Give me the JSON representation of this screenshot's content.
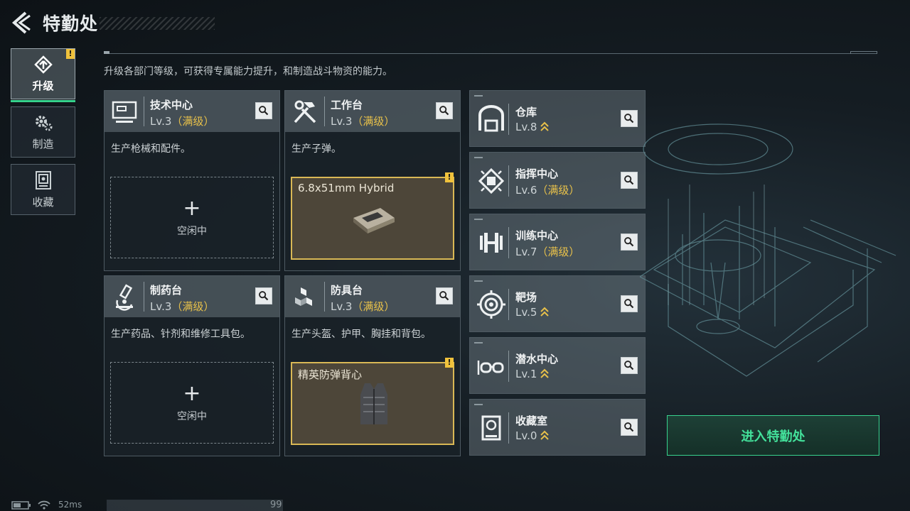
{
  "header": {
    "title": "特勤处",
    "subtitle": "升级各部门等级，可获得专属能力提升，和制造战斗物资的能力。"
  },
  "sidebar": {
    "items": [
      {
        "label": "升级",
        "icon": "upgrade-icon",
        "active": true,
        "badge": "!"
      },
      {
        "label": "制造",
        "icon": "gears-icon",
        "active": false
      },
      {
        "label": "收藏",
        "icon": "collection-icon",
        "active": false
      }
    ]
  },
  "cards": [
    {
      "name": "技术中心",
      "level": "Lv.3",
      "max": "（满级）",
      "desc": "生产枪械和配件。",
      "icon": "monitor-icon",
      "slot": {
        "type": "idle",
        "plus": "+",
        "label": "空闲中"
      }
    },
    {
      "name": "工作台",
      "level": "Lv.3",
      "max": "（满级）",
      "desc": "生产子弹。",
      "icon": "hammer-wrench-icon",
      "slot": {
        "type": "item",
        "item_name": "6.8x51mm Hybrid",
        "badge": "!",
        "item_icon": "ammo-box-icon"
      }
    },
    {
      "name": "制药台",
      "level": "Lv.3",
      "max": "（满级）",
      "desc": "生产药品、针剂和维修工具包。",
      "icon": "microscope-icon",
      "slot": {
        "type": "idle",
        "plus": "+",
        "label": "空闲中"
      }
    },
    {
      "name": "防具台",
      "level": "Lv.3",
      "max": "（满级）",
      "desc": "生产头盔、护甲、胸挂和背包。",
      "icon": "cubes-icon",
      "slot": {
        "type": "item",
        "item_name": "精英防弹背心",
        "badge": "!",
        "item_icon": "vest-icon"
      }
    }
  ],
  "facilities": [
    {
      "name": "仓库",
      "level": "Lv.8",
      "max": "",
      "upgradable": true,
      "icon": "warehouse-icon"
    },
    {
      "name": "指挥中心",
      "level": "Lv.6",
      "max": "（满级）",
      "upgradable": false,
      "icon": "chip-icon"
    },
    {
      "name": "训练中心",
      "level": "Lv.7",
      "max": "（满级）",
      "upgradable": false,
      "icon": "dumbbell-icon"
    },
    {
      "name": "靶场",
      "level": "Lv.5",
      "max": "",
      "upgradable": true,
      "icon": "target-icon"
    },
    {
      "name": "潜水中心",
      "level": "Lv.1",
      "max": "",
      "upgradable": true,
      "icon": "goggles-icon"
    },
    {
      "name": "收藏室",
      "level": "Lv.0",
      "max": "",
      "upgradable": true,
      "icon": "collection-room-icon"
    }
  ],
  "enter_button": "进入特勤处",
  "status": {
    "ping": "52ms",
    "number": "99"
  },
  "colors": {
    "accent": "#37d28d",
    "max_level": "#e8c14a",
    "badge": "#f0c23c"
  }
}
